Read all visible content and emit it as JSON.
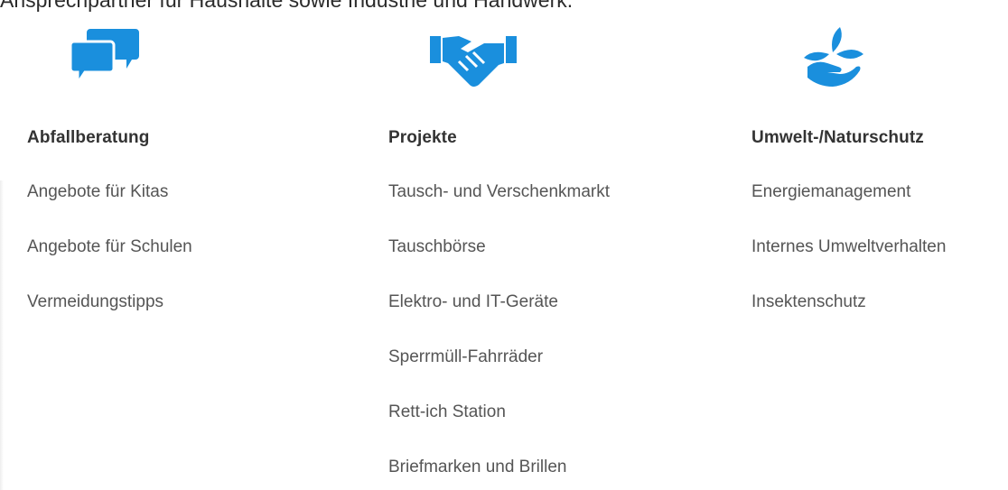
{
  "intro": {
    "text": "Ansprechpartner für Haushalte sowie Industrie und Handwerk."
  },
  "colors": {
    "icon_blue": "#1a8fdd",
    "heading_text": "#333333",
    "link_text": "#555555"
  },
  "columns": [
    {
      "icon": "speech-bubbles-icon",
      "heading": "Abfallberatung",
      "links": [
        "Angebote für Kitas",
        "Angebote für Schulen",
        "Vermeidungstipps"
      ]
    },
    {
      "icon": "handshake-icon",
      "heading": "Projekte",
      "links": [
        "Tausch- und Verschenkmarkt",
        "Tauschbörse",
        "Elektro- und IT-Geräte",
        "Sperrmüll-Fahrräder",
        "Rett-ich Station",
        "Briefmarken und Brillen"
      ]
    },
    {
      "icon": "leaf-hand-icon",
      "heading": "Umwelt-/Naturschutz",
      "links": [
        "Energiemanagement",
        "Internes Umweltverhalten",
        "Insektenschutz"
      ]
    }
  ]
}
